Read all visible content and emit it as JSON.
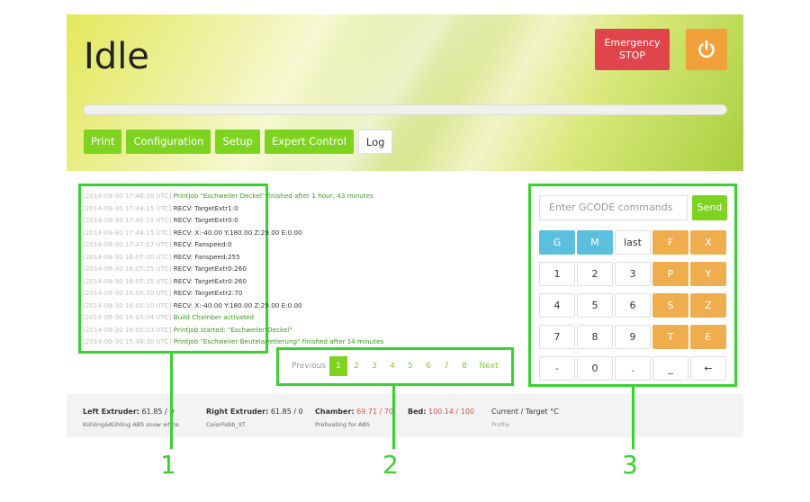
{
  "header": {
    "state_title": "Idle",
    "emergency_stop": [
      "Emergency",
      "STOP"
    ],
    "power_icon": "power-icon",
    "progress": 0,
    "tabs": [
      {
        "label": "Print",
        "active": false
      },
      {
        "label": "Configuration",
        "active": false
      },
      {
        "label": "Setup",
        "active": false
      },
      {
        "label": "Expert Control",
        "active": false
      },
      {
        "label": "Log",
        "active": true
      }
    ]
  },
  "log": [
    {
      "ts": "[2014-09-30 17:48:16 UTC]",
      "msg": "Printjob \"Eschweiler Deckel\" finished after 1 hour, 43 minutes",
      "color": "green"
    },
    {
      "ts": "[2014-09-30 17:48:15 UTC]",
      "msg": "RECV: TargetExtr1:0",
      "color": "dark"
    },
    {
      "ts": "[2014-09-30 17:48:15 UTC]",
      "msg": "RECV: TargetExtr0:0",
      "color": "dark"
    },
    {
      "ts": "[2014-09-30 17:48:15 UTC]",
      "msg": "RECV: X:-40.00 Y:180.00 Z:29.00 E:0.00",
      "color": "dark"
    },
    {
      "ts": "[2014-09-30 17:47:57 UTC]",
      "msg": "RECV: Fanspeed:0",
      "color": "dark"
    },
    {
      "ts": "[2014-09-30 16:07:00 UTC]",
      "msg": "RECV: Fanspeed:255",
      "color": "dark"
    },
    {
      "ts": "[2014-09-30 16:05:25 UTC]",
      "msg": "RECV: TargetExtr0:260",
      "color": "dark"
    },
    {
      "ts": "[2014-09-30 16:05:25 UTC]",
      "msg": "RECV: TargetExtr0:260",
      "color": "dark"
    },
    {
      "ts": "[2014-09-30 16:05:10 UTC]",
      "msg": "RECV: TargetExtr2:70",
      "color": "dark"
    },
    {
      "ts": "[2014-09-30 16:05:10 UTC]",
      "msg": "RECV: X:-40.00 Y:180.00 Z:29.00 E:0.00",
      "color": "dark"
    },
    {
      "ts": "[2014-09-30 16:05:04 UTC]",
      "msg": "Build Chamber activated",
      "color": "green"
    },
    {
      "ts": "[2014-09-30 16:05:03 UTC]",
      "msg": "Printjob started: \"Eschweiler Deckel\"",
      "color": "green"
    },
    {
      "ts": "[2014-09-30 15:48:30 UTC]",
      "msg": "Printjob \"Eschweiler Beutelarretierung\" finished after 14 minutes",
      "color": "green"
    }
  ],
  "pagination": {
    "previous": "Previous",
    "pages": [
      "1",
      "2",
      "3",
      "4",
      "5",
      "6",
      "7",
      "8"
    ],
    "active_page": "1",
    "next": "Next"
  },
  "gcode": {
    "placeholder": "Enter GCODE commands",
    "send": "Send",
    "keys": [
      [
        "G",
        "M",
        "last",
        "F",
        "X"
      ],
      [
        "1",
        "2",
        "3",
        "P",
        "Y"
      ],
      [
        "4",
        "5",
        "6",
        "S",
        "Z"
      ],
      [
        "7",
        "8",
        "9",
        "T",
        "E"
      ],
      [
        "-",
        "0",
        ".",
        "_",
        "←"
      ]
    ],
    "key_styles": [
      [
        "blue",
        "blue",
        "plain",
        "orange",
        "orange"
      ],
      [
        "plain",
        "plain",
        "plain",
        "orange",
        "orange"
      ],
      [
        "plain",
        "plain",
        "plain",
        "orange",
        "orange"
      ],
      [
        "plain",
        "plain",
        "plain",
        "orange",
        "orange"
      ],
      [
        "plain",
        "plain",
        "plain",
        "plain",
        "plain"
      ]
    ]
  },
  "status": {
    "left_extruder": {
      "label": "Left Extruder:",
      "value": "61.85 / 0",
      "material": "Kühling&Kühling ABS snow white"
    },
    "right_extruder": {
      "label": "Right Extruder:",
      "value": "61.85 / 0",
      "material": "ColorFabb_XT"
    },
    "chamber": {
      "label": "Chamber:",
      "value": "69.71 / 70",
      "sub": "Preheating for ABS"
    },
    "bed": {
      "label": "Bed:",
      "value": "100.14 / 100"
    },
    "legend": {
      "label": "Current / Target °C",
      "sub": "Profile"
    }
  },
  "callouts": [
    "1",
    "2",
    "3"
  ],
  "colors": {
    "accent_green": "#7ed321",
    "callout_green": "#39d32f",
    "estop_red": "#e0454c",
    "power_orange": "#f2a13a",
    "key_blue": "#5bc0de",
    "key_orange": "#f0ad4e"
  }
}
